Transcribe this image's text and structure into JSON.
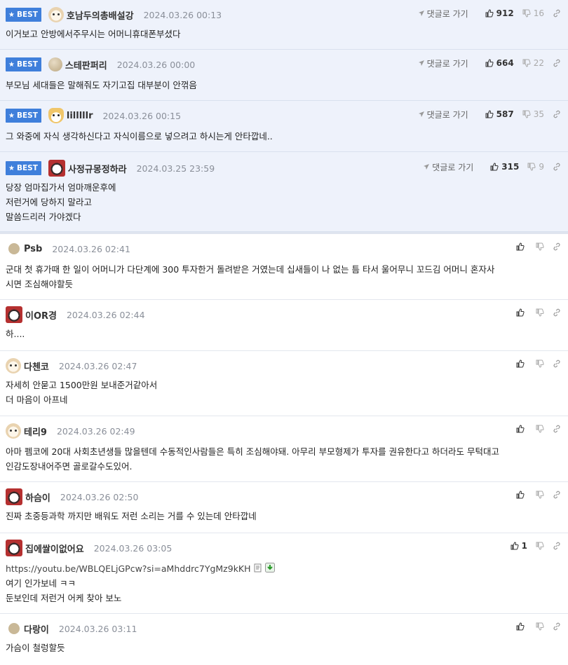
{
  "best_label": "BEST",
  "goto_label": "댓글로 가기",
  "best_comments": [
    {
      "nick": "호남두의총배설강",
      "date": "2024.03.26 00:13",
      "lines": [
        "이거보고 안방에서주무시는 어머니휴대폰부셨다"
      ],
      "up": "912",
      "down": "16",
      "avatar": "dog"
    },
    {
      "nick": "스테판퍼리",
      "date": "2024.03.26 00:00",
      "lines": [
        "부모님 세대들은 말해줘도 자기고집 대부분이 안꺾음"
      ],
      "up": "664",
      "down": "22",
      "avatar": "stone"
    },
    {
      "nick": "lilllllr",
      "date": "2024.03.26 00:15",
      "lines": [
        "그 와중에 자식 생각하신다고 자식이름으로 넣으려고 하시는게 안타깝네.."
      ],
      "up": "587",
      "down": "35",
      "avatar": "fox"
    },
    {
      "nick": "사정규몽정하라",
      "date": "2024.03.25 23:59",
      "lines": [
        "당장 엄마집가서 엄마깨운후에",
        "저런거에 당하지 말라고",
        "말씀드리러 가야겠다"
      ],
      "up": "315",
      "down": "9",
      "avatar": "panda"
    }
  ],
  "comments": [
    {
      "nick": "Psb",
      "date": "2024.03.26 02:41",
      "lines": [
        "군대 첫 휴가때 한 일이 어머니가 다단계에 300 투자한거 돌려받은 거였는데 십새들이 나 없는 틈 타서 울어무니 꼬드김 어머니 혼자사",
        "시면 조심해야할듯"
      ],
      "up": "",
      "avatar": "dot"
    },
    {
      "nick": "이OR경",
      "date": "2024.03.26 02:44",
      "lines": [
        "하...."
      ],
      "up": "",
      "avatar": "panda"
    },
    {
      "nick": "다첸코",
      "date": "2024.03.26 02:47",
      "lines": [
        "자세히 안묻고 1500만원 보내준거같아서",
        "더 마음이 아프네"
      ],
      "up": "",
      "avatar": "dog"
    },
    {
      "nick": "테리9",
      "date": "2024.03.26 02:49",
      "lines": [
        "아마 펨코에 20대 사회초년생들 많을텐데 수동적인사람들은 특히 조심해야돼. 아무리 부모형제가 투자를 권유한다고 하더라도 무턱대고",
        "인감도장내어주면 골로갈수도있어."
      ],
      "up": "",
      "avatar": "dog"
    },
    {
      "nick": "하슴이",
      "date": "2024.03.26 02:50",
      "lines": [
        "진짜 초중등과학 까지만 배워도 저런 소리는 거를 수 있는데 안타깝네"
      ],
      "up": "",
      "avatar": "panda"
    },
    {
      "nick": "집에쌀이없어요",
      "date": "2024.03.26 03:05",
      "url": "https://youtu.be/WBLQELjGPcw?si=aMhddrc7YgMz9kKH",
      "lines": [
        "여기 인가보네 ㅋㅋ",
        "둔보인데 저런거 어케 찾아 보노"
      ],
      "up": "1",
      "avatar": "panda"
    },
    {
      "nick": "다랑이",
      "date": "2024.03.26 03:11",
      "lines": [
        "가슴이 철렁할듯"
      ],
      "up": "",
      "avatar": "dot"
    }
  ]
}
